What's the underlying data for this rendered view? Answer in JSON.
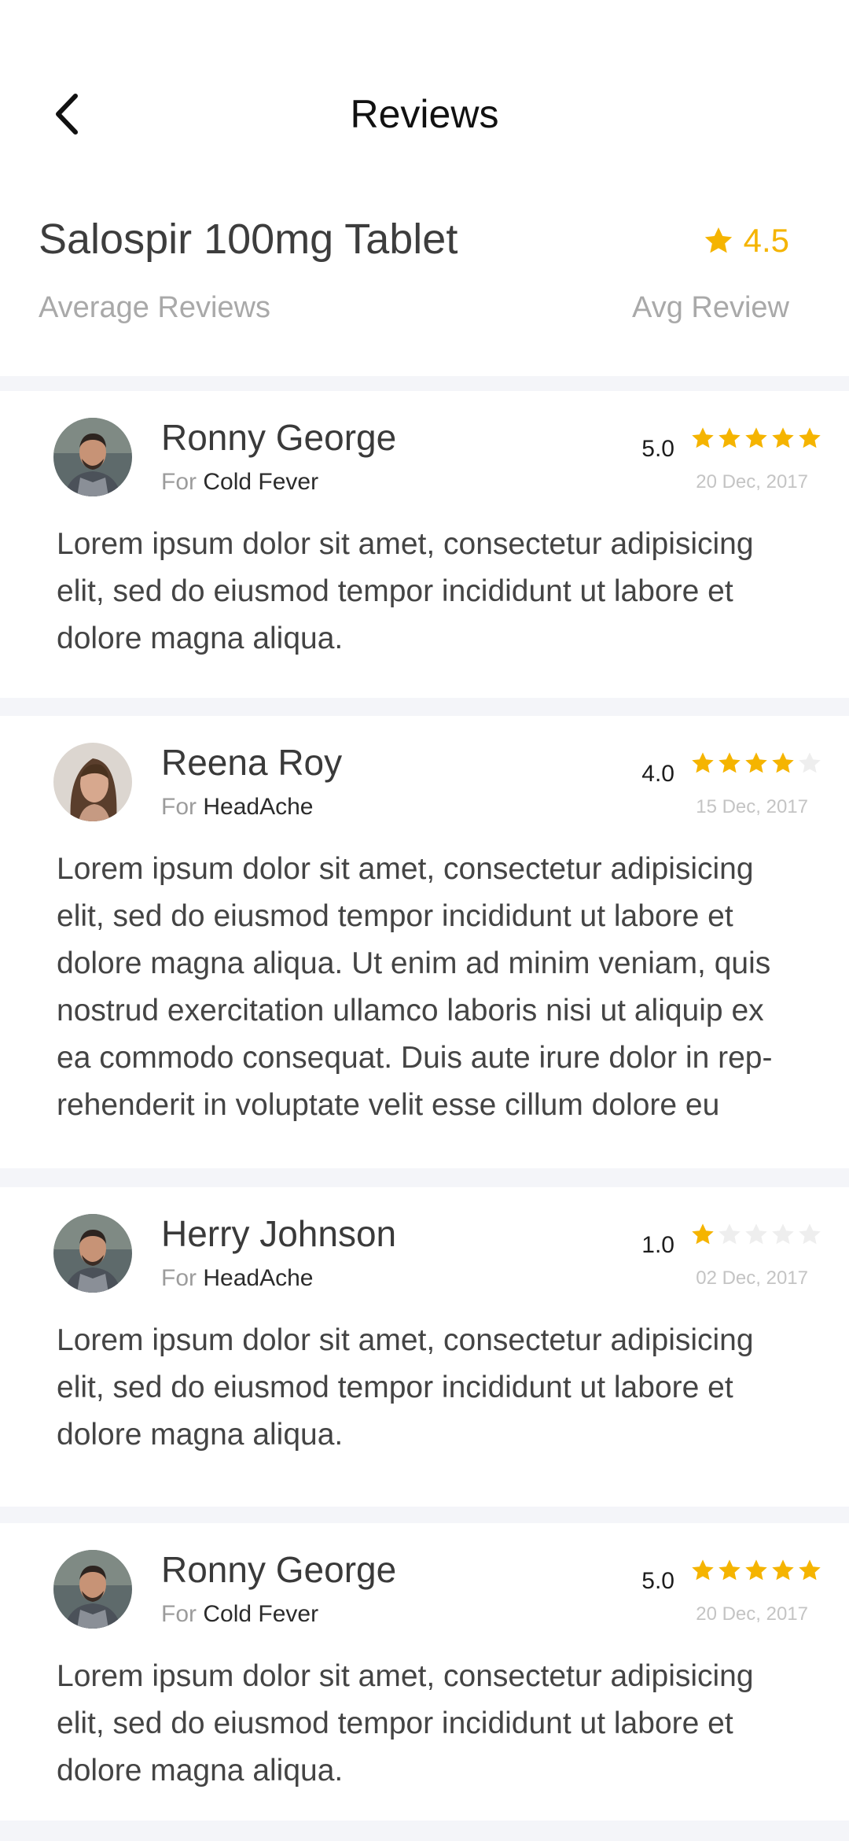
{
  "header": {
    "title": "Reviews",
    "back_icon": "chevron-left-icon",
    "product_name": "Salospir 100mg Tablet",
    "average_rating": "4.5",
    "average_label": "Average Reviews",
    "avg_review_label": "Avg Review"
  },
  "colors": {
    "star_filled": "#f5b400",
    "star_empty": "#eeeeee",
    "background": "#f4f5f9"
  },
  "reviews": [
    {
      "name": "Ronny George",
      "for_label": "For",
      "condition": "Cold Fever",
      "score": "5.0",
      "stars_filled": 5,
      "date": "20 Dec, 2017",
      "text": "Lorem ipsum dolor sit amet, consectetur adipisicing elit, sed do eiusmod tempor incididunt ut labore et dolore magna aliqua.",
      "avatar": "man-avatar"
    },
    {
      "name": "Reena Roy",
      "for_label": "For",
      "condition": "HeadAche",
      "score": "4.0",
      "stars_filled": 4,
      "date": "15 Dec, 2017",
      "text": "Lorem ipsum dolor sit amet, consectetur adipisicing elit, sed do eiusmod tempor incididunt ut labore et dolore magna aliqua. Ut enim ad minim veniam, quis nostrud exercitation ullamco laboris nisi ut aliquip ex ea commodo consequat. Duis aute irure dolor in rep-rehenderit in voluptate velit esse cillum dolore eu",
      "avatar": "woman-avatar"
    },
    {
      "name": "Herry Johnson",
      "for_label": "For",
      "condition": "HeadAche",
      "score": "1.0",
      "stars_filled": 1,
      "date": "02 Dec, 2017",
      "text": "Lorem ipsum dolor sit amet, consectetur adipisicing elit, sed do eiusmod tempor incididunt ut labore et dolore magna aliqua.",
      "avatar": "man-avatar"
    },
    {
      "name": "Ronny George",
      "for_label": "For",
      "condition": "Cold Fever",
      "score": "5.0",
      "stars_filled": 5,
      "date": "20 Dec, 2017",
      "text": "Lorem ipsum dolor sit amet, consectetur adipisicing elit, sed do eiusmod tempor incididunt ut labore et dolore magna aliqua.",
      "avatar": "man-avatar"
    }
  ]
}
